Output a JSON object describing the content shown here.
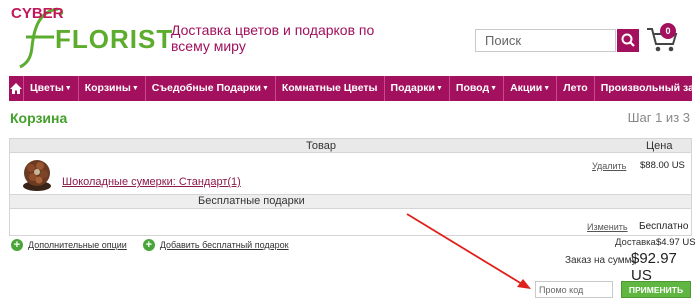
{
  "header": {
    "logo_line1": "CYBER",
    "logo_line2": "FLORIST",
    "tagline": "Доставка цветов и подарков по всему миру",
    "search_placeholder": "Поиск",
    "cart_count": "0"
  },
  "nav": {
    "items": [
      {
        "label": "Цветы",
        "caret": true
      },
      {
        "label": "Корзины",
        "caret": true
      },
      {
        "label": "Съедобные Подарки",
        "caret": true
      },
      {
        "label": "Комнатные Цветы",
        "caret": false
      },
      {
        "label": "Подарки",
        "caret": true
      },
      {
        "label": "Повод",
        "caret": true
      },
      {
        "label": "Акции",
        "caret": true
      },
      {
        "label": "Лето",
        "caret": false
      },
      {
        "label": "Произвольный заказ",
        "caret": false
      }
    ]
  },
  "cart": {
    "title": "Корзина",
    "step": "Шаг 1 из 3",
    "col_product": "Товар",
    "col_price": "Цена",
    "item": {
      "name": "Шоколадные сумерки: Стандарт(1)",
      "remove_label": "Удалить",
      "price": "$88.00 US"
    },
    "gifts_header": "Бесплатные подарки",
    "gift_change_label": "Изменить",
    "gift_value": "Бесплатно",
    "option_additional": "Дополнительные опции",
    "option_add_gift": "Добавить бесплатный подарок",
    "delivery_label": "Доставка",
    "delivery_value": "$4.97 US",
    "total_label": "Заказ на сумму",
    "total_value": "$92.97 US",
    "promo_placeholder": "Промо код",
    "apply_label": "ПРИМЕНИТЬ"
  },
  "colors": {
    "brand_magenta": "#a3115e",
    "brand_green": "#5cac2e",
    "annotation_arrow": "#e0201b"
  }
}
